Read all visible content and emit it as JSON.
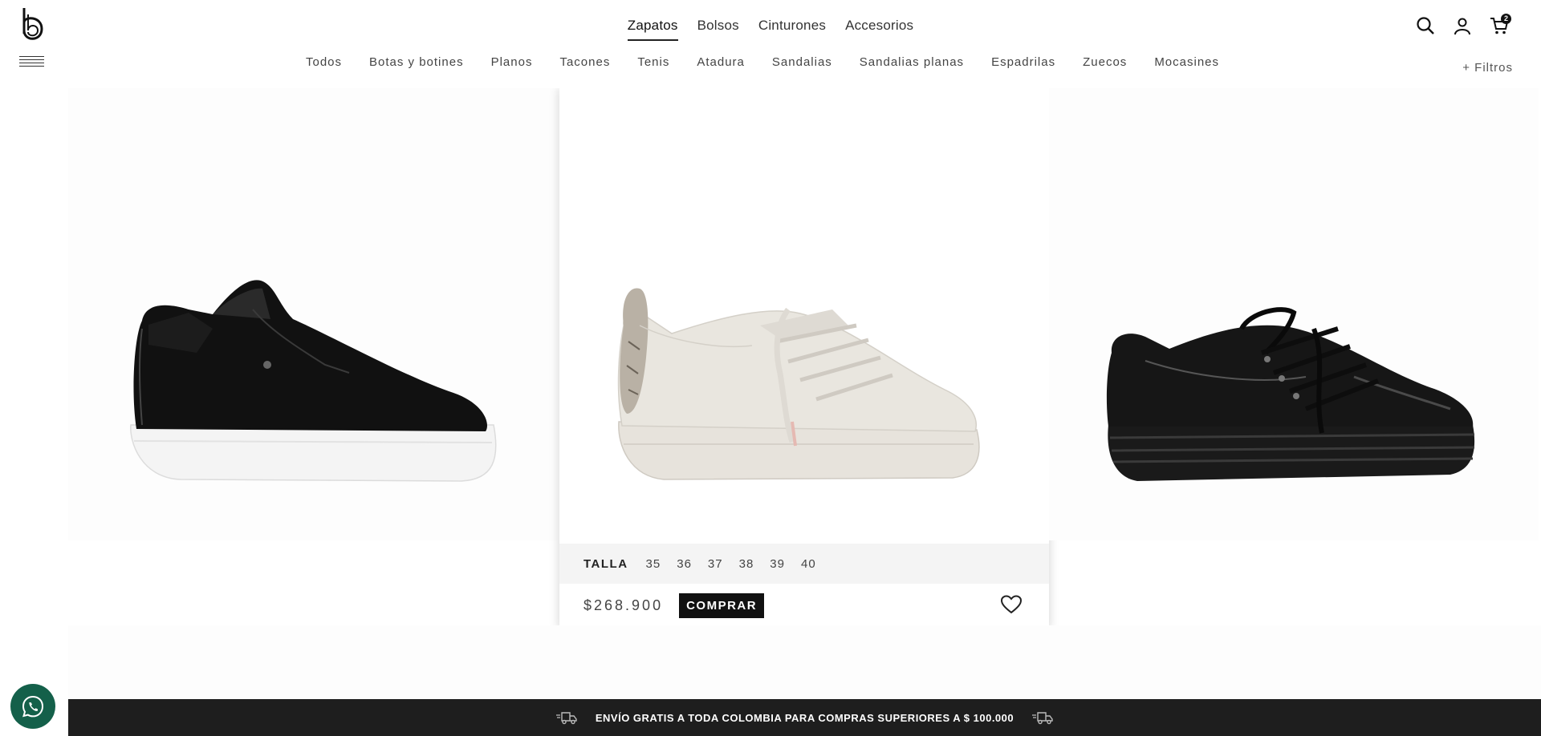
{
  "header": {
    "primary_nav": [
      {
        "label": "Zapatos",
        "active": true
      },
      {
        "label": "Bolsos",
        "active": false
      },
      {
        "label": "Cinturones",
        "active": false
      },
      {
        "label": "Accesorios",
        "active": false
      }
    ],
    "secondary_nav": [
      "Todos",
      "Botas y botines",
      "Planos",
      "Tacones",
      "Tenis",
      "Atadura",
      "Sandalias",
      "Sandalias planas",
      "Espadrilas",
      "Zuecos",
      "Mocasines"
    ],
    "cart_count": "2",
    "filters_label": "+ Filtros"
  },
  "products": [
    {
      "color": "black-white-sole"
    },
    {
      "color": "cream",
      "size_label": "TALLA",
      "sizes": [
        "35",
        "36",
        "37",
        "38",
        "39",
        "40"
      ],
      "price": "$268.900",
      "buy_label": "COMPRAR"
    },
    {
      "color": "black-patent"
    }
  ],
  "banner": {
    "text": "ENVÍO GRATIS A TODA COLOMBIA PARA COMPRAS SUPERIORES A $ 100.000"
  },
  "colors": {
    "banner_bg": "#1e1e1e",
    "whatsapp": "#14604a",
    "buy_button": "#111111"
  }
}
